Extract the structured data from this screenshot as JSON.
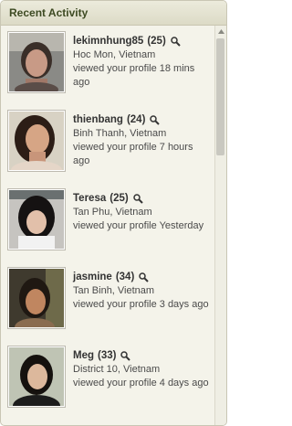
{
  "panel": {
    "title": "Recent Activity"
  },
  "items": [
    {
      "name": "lekimnhung85",
      "age": "(25)",
      "location": "Hoc Mon, Vietnam",
      "activity": "viewed your profile 18 mins ago",
      "icon": "search-icon"
    },
    {
      "name": "thienbang",
      "age": "(24)",
      "location": "Binh Thanh, Vietnam",
      "activity": "viewed your profile 7 hours ago",
      "icon": "search-icon"
    },
    {
      "name": "Teresa",
      "age": "(25)",
      "location": "Tan Phu, Vietnam",
      "activity": "viewed your profile Yesterday",
      "icon": "search-icon"
    },
    {
      "name": "jasmine",
      "age": "(34)",
      "location": "Tan Binh, Vietnam",
      "activity": "viewed your profile 3 days ago",
      "icon": "search-icon"
    },
    {
      "name": "Meg",
      "age": "(33)",
      "location": "District 10, Vietnam",
      "activity": "viewed your profile 4 days ago",
      "icon": "search-icon"
    }
  ],
  "colors": {
    "header_text": "#3d4a22",
    "panel_bg": "#f4f3ea",
    "border": "#c9c6b4"
  }
}
